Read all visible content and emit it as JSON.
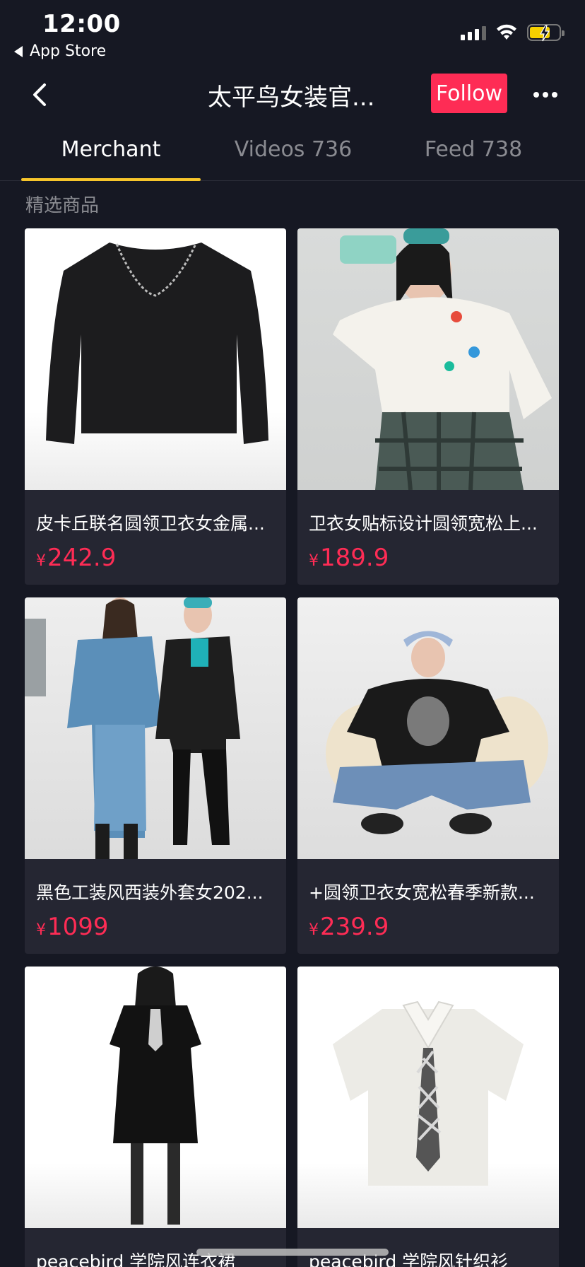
{
  "status_bar": {
    "time": "12:00",
    "back_app": "App Store",
    "icons": [
      "signal-icon",
      "wifi-icon",
      "battery-charging-icon"
    ],
    "battery_color": "#f5d000"
  },
  "nav": {
    "title": "太平鸟女装官...",
    "follow_label": "Follow",
    "follow_color": "#fe2c55"
  },
  "tabs": [
    {
      "label": "Merchant",
      "active": true
    },
    {
      "label": "Videos 736",
      "active": false
    },
    {
      "label": "Feed 738",
      "active": false
    }
  ],
  "accent_color": "#f7c52b",
  "section_label": "精选商品",
  "products": [
    {
      "title": "皮卡丘联名圆领卫衣女金属...",
      "currency": "¥",
      "price": "242.9",
      "image": "black-sweatshirt-with-chain"
    },
    {
      "title": "卫衣女贴标设计圆领宽松上...",
      "currency": "¥",
      "price": "189.9",
      "image": "woman-white-sweatshirt-camera"
    },
    {
      "title": "黑色工装风西装外套女202...",
      "currency": "¥",
      "price": "1099",
      "image": "two-women-blazers"
    },
    {
      "title": "+圆领卫衣女宽松春季新款...",
      "currency": "¥",
      "price": "239.9",
      "image": "woman-black-sweatshirt-bear"
    },
    {
      "title": "peacebird 学院风连衣裙",
      "currency": "",
      "price": "",
      "image": "woman-black-dress"
    },
    {
      "title": "peacebird 学院风针织衫",
      "currency": "",
      "price": "",
      "image": "white-polo-with-tie"
    }
  ]
}
